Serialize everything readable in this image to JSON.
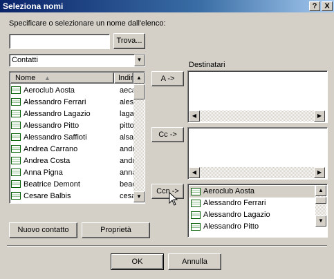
{
  "window": {
    "title": "Seleziona nomi",
    "help": "?",
    "close": "X"
  },
  "prompt": "Specificare o selezionare un nome dall'elenco:",
  "search": {
    "value": "",
    "button": "Trova..."
  },
  "addressbook": {
    "selected": "Contatti"
  },
  "list": {
    "columns": [
      "Nome",
      "Indiri"
    ],
    "rows": [
      {
        "name": "Aeroclub Aosta",
        "addr": "aeca",
        "selected": false
      },
      {
        "name": "Alessandro Ferrari",
        "addr": "aless",
        "selected": false
      },
      {
        "name": "Alessandro Lagazio",
        "addr": "lagaz",
        "selected": false
      },
      {
        "name": "Alessandro Pitto",
        "addr": "pitto(",
        "selected": false
      },
      {
        "name": "Alessandro Saffioti",
        "addr": "alsaff",
        "selected": false
      },
      {
        "name": "Andrea Carrano",
        "addr": "andre",
        "selected": false
      },
      {
        "name": "Andrea Costa",
        "addr": "andre",
        "selected": false
      },
      {
        "name": "Anna Pigna",
        "addr": "anna",
        "selected": false
      },
      {
        "name": "Beatrice Demont",
        "addr": "bead",
        "selected": true
      },
      {
        "name": "Cesare Balbis",
        "addr": "cesa",
        "selected": false
      }
    ]
  },
  "buttons": {
    "new_contact": "Nuovo contatto",
    "properties": "Proprietà",
    "to": "A ->",
    "cc": "Cc ->",
    "bcc": "Ccn ->",
    "ok": "OK",
    "cancel": "Annulla"
  },
  "recipients_label": "Destinatari",
  "bcc_list": [
    "Aeroclub Aosta",
    "Alessandro Ferrari",
    "Alessandro Lagazio",
    "Alessandro Pitto"
  ]
}
